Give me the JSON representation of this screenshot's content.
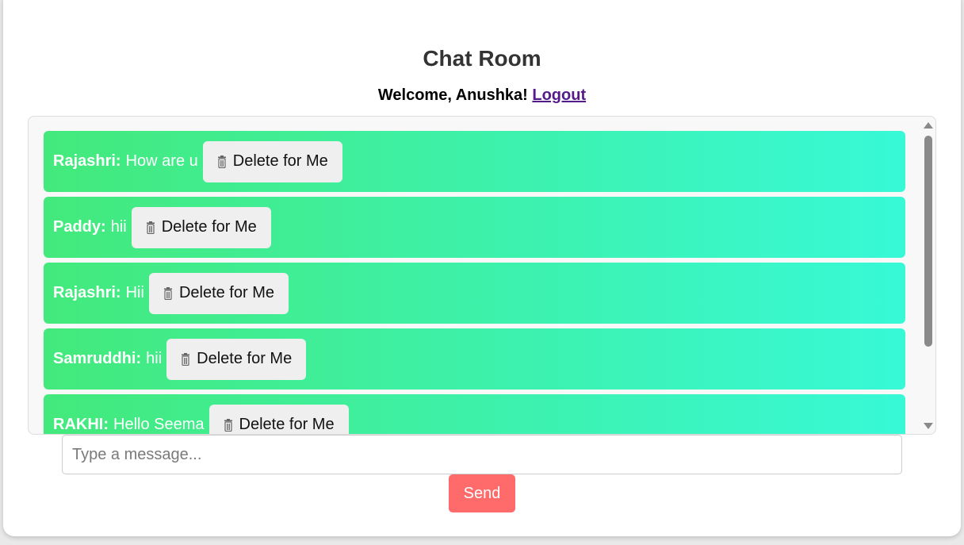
{
  "page": {
    "title": "Chat Room",
    "welcome_prefix": "Welcome, Anushka!",
    "logout_label": "Logout"
  },
  "messages": [
    {
      "sender": "Rajashri:",
      "text": "How are u",
      "delete_label": "Delete for Me"
    },
    {
      "sender": "Paddy:",
      "text": "hii",
      "delete_label": "Delete for Me"
    },
    {
      "sender": "Rajashri:",
      "text": "Hii",
      "delete_label": "Delete for Me"
    },
    {
      "sender": "Samruddhi:",
      "text": "hii",
      "delete_label": "Delete for Me"
    },
    {
      "sender": "RAKHI:",
      "text": "Hello Seema",
      "delete_label": "Delete for Me"
    }
  ],
  "composer": {
    "placeholder": "Type a message...",
    "value": "",
    "send_label": "Send"
  },
  "icons": {
    "delete": "trash-icon"
  },
  "colors": {
    "message_gradient_start": "#43e97b",
    "message_gradient_end": "#38f9d7",
    "send_button": "#ff6b6b",
    "logout_link": "#551a8b"
  }
}
